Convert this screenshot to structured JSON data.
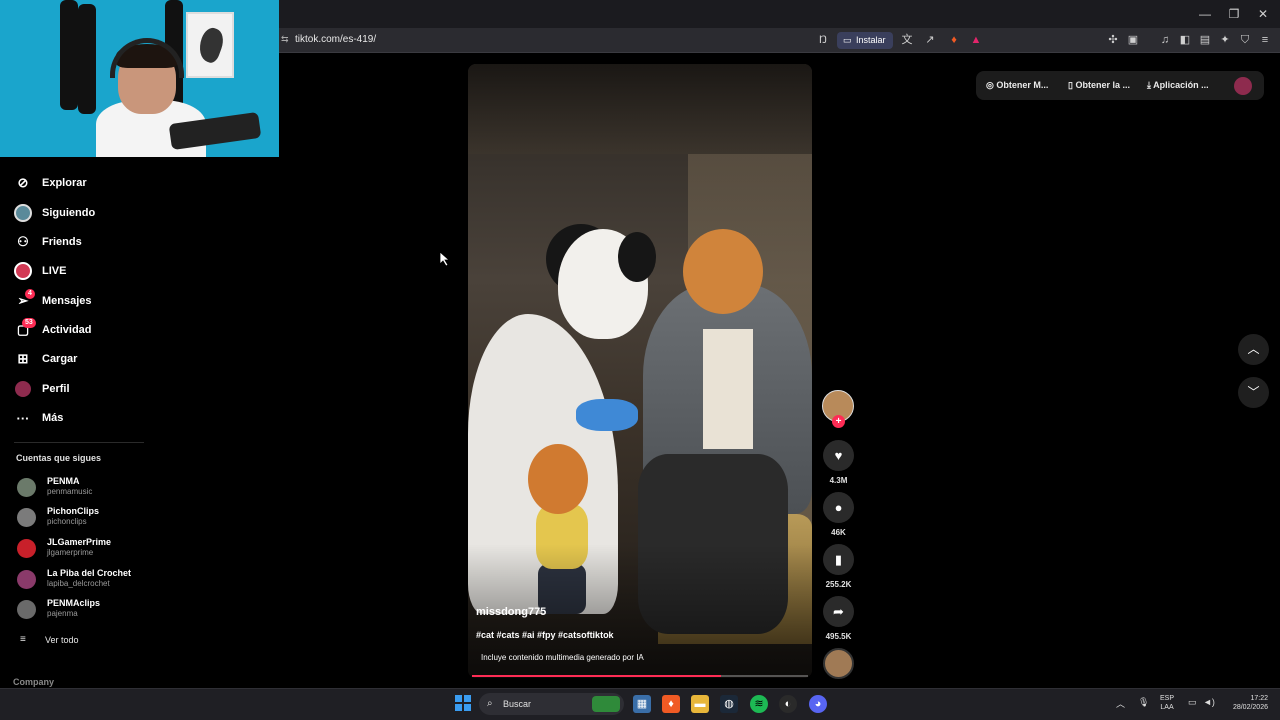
{
  "browser": {
    "url": "tiktok.com/es-419/",
    "install_label": "Instalar"
  },
  "sidebar": {
    "items": [
      {
        "label": "Explorar",
        "icon": "compass-icon"
      },
      {
        "label": "Siguiendo",
        "icon": "following-avatar-icon"
      },
      {
        "label": "Friends",
        "icon": "friends-icon"
      },
      {
        "label": "LIVE",
        "icon": "live-icon"
      },
      {
        "label": "Mensajes",
        "icon": "messages-icon",
        "badge": "4"
      },
      {
        "label": "Actividad",
        "icon": "activity-icon",
        "badge": "53"
      },
      {
        "label": "Cargar",
        "icon": "upload-icon"
      },
      {
        "label": "Perfil",
        "icon": "profile-avatar-icon"
      },
      {
        "label": "Más",
        "icon": "more-icon"
      }
    ],
    "following_title": "Cuentas que sigues",
    "accounts": [
      {
        "name": "PENMA",
        "handle": "penmamusic",
        "color": "#6b7a6a"
      },
      {
        "name": "PichonClips",
        "handle": "pichonclips",
        "color": "#7b7b7b"
      },
      {
        "name": "JLGamerPrime",
        "handle": "jlgamerprime",
        "color": "#c8202a"
      },
      {
        "name": "La Piba del Crochet",
        "handle": "lapiba_delcrochet",
        "color": "#8a3a6a"
      },
      {
        "name": "PENMAclips",
        "handle": "pajenma",
        "color": "#6a6a6a"
      }
    ],
    "see_all": "Ver todo",
    "company": "Company"
  },
  "tt_toolbar": {
    "buttons": [
      "Obtener M...",
      "Obtener la ...",
      "Aplicación ..."
    ]
  },
  "video": {
    "author": "missdong775",
    "tags": "#cat #cats #ai #fpy #catsoftiktok",
    "ai_notice": "Incluye contenido multimedia generado por IA",
    "progress": 0.74
  },
  "actions": {
    "likes": "4.3M",
    "comments": "46K",
    "saves": "255.2K",
    "shares": "495.5K"
  },
  "taskbar": {
    "search_label": "Buscar",
    "lang_line1": "ESP",
    "lang_line2": "LAA",
    "time": "17:22",
    "date": "28/02/2026"
  },
  "colors": {
    "accent": "#fe2c55",
    "background": "#000000"
  }
}
